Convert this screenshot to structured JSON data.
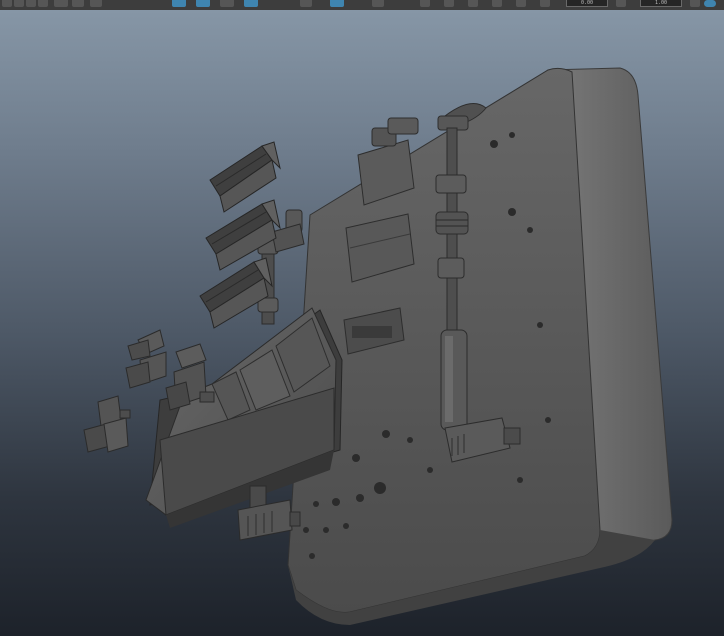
{
  "app": {
    "viewport_label": "",
    "toolbar": {
      "near_clip_value": "0.00",
      "far_clip_value": "1.00"
    }
  },
  "colors": {
    "viewport_top": "#8696a6",
    "viewport_bottom": "#1d222a",
    "toolbar_bg": "#3d3d3d",
    "active_tool": "#3f85b0",
    "model_light": "#6a6a6a",
    "model_mid": "#555555",
    "model_dark": "#3a3a3a"
  },
  "icons": [
    "snap-grid-icon",
    "snap-curve-icon",
    "snap-point-icon",
    "snap-plane-icon",
    "camera-icon",
    "wireframe-shading-icon",
    "smooth-shading-icon",
    "textured-icon",
    "lighting-icon",
    "shadows-icon",
    "isolate-select-icon",
    "xray-icon",
    "grid-icon",
    "resolution-gate-icon"
  ]
}
